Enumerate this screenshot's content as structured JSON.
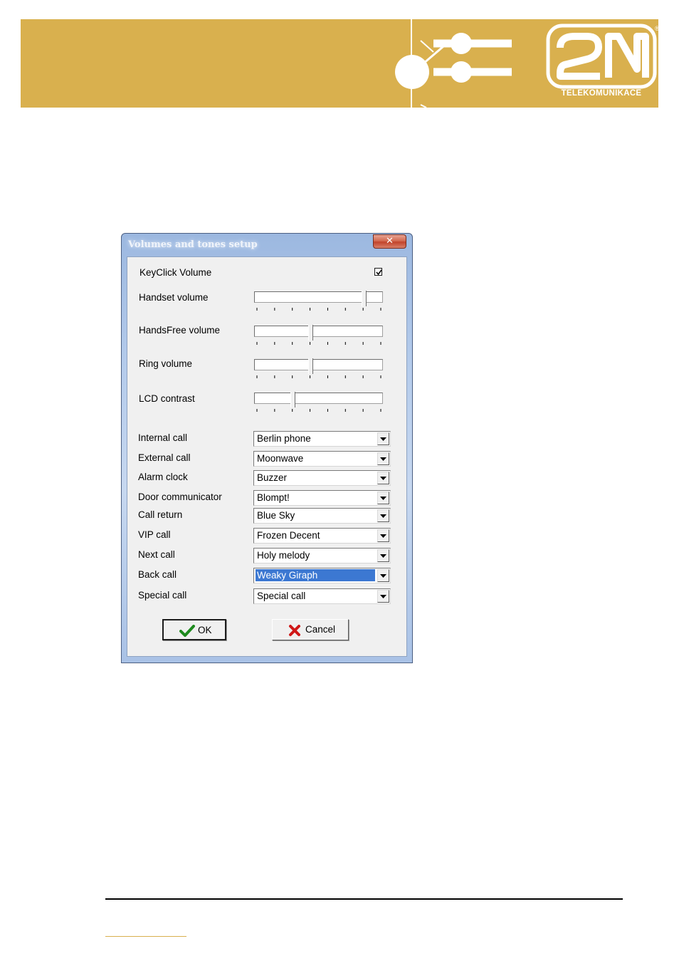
{
  "brand": {
    "logo_mark": "2N",
    "logo_subtitle": "TELEKOMUNIKACE",
    "registered_mark": "®",
    "banner_color": "#d9b04e"
  },
  "dialog": {
    "title": "Volumes and tones setup",
    "close_label": "✕",
    "keyclick": {
      "label": "KeyClick Volume",
      "checked": true
    },
    "sliders": [
      {
        "label": "Handset volume",
        "level": 0.86
      },
      {
        "label": "HandsFree volume",
        "level": 0.43
      },
      {
        "label": "Ring volume",
        "level": 0.43
      },
      {
        "label": "LCD contrast",
        "level": 0.29
      }
    ],
    "tones": [
      {
        "label": "Internal call",
        "value": "Berlin phone"
      },
      {
        "label": "External call",
        "value": "Moonwave"
      },
      {
        "label": "Alarm clock",
        "value": "Buzzer"
      },
      {
        "label": "Door communicator",
        "value": "Blompt!"
      },
      {
        "label": "Call return",
        "value": "Blue Sky"
      },
      {
        "label": "VIP call",
        "value": "Frozen Decent"
      },
      {
        "label": "Next call",
        "value": "Holy melody"
      },
      {
        "label": "Back call",
        "value": "Weaky Giraph",
        "selected": true
      },
      {
        "label": "Special call",
        "value": "Special call"
      }
    ],
    "buttons": {
      "ok_label": "OK",
      "cancel_label": "Cancel",
      "ok_icon": "checkmark-icon",
      "cancel_icon": "red-x-icon"
    },
    "colors": {
      "selection": "#3c78d2",
      "ok_icon": "#1e8a1e",
      "cancel_icon": "#d01818"
    }
  }
}
